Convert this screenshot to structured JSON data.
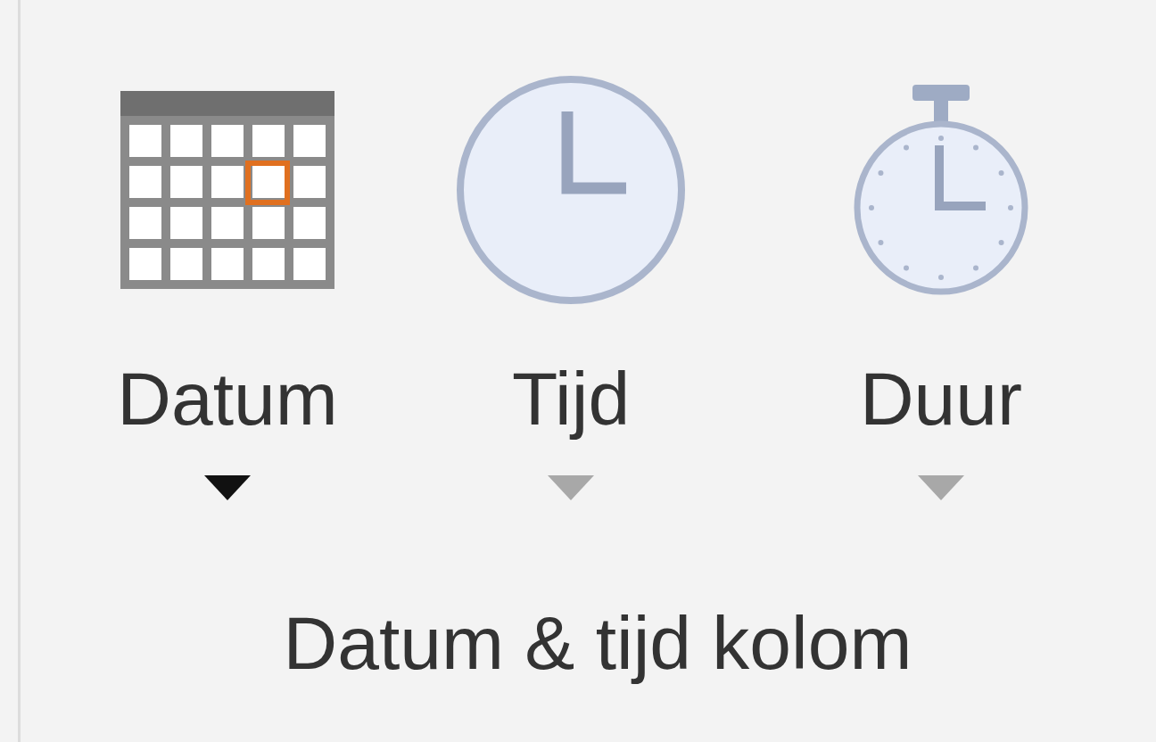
{
  "buttons": [
    {
      "kind": "calendar",
      "label": "Datum",
      "disabled": false
    },
    {
      "kind": "clock",
      "label": "Tijd",
      "disabled": true
    },
    {
      "kind": "stopwatch",
      "label": "Duur",
      "disabled": true
    }
  ],
  "group_label": "Datum & tijd kolom"
}
